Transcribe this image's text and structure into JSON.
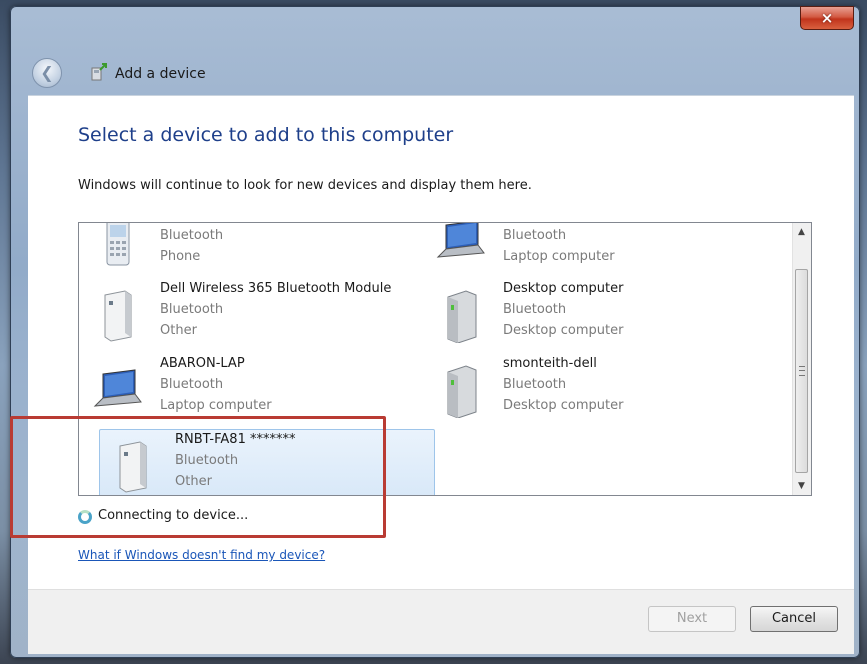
{
  "window": {
    "title": "Add a device",
    "close_label": "×"
  },
  "main": {
    "heading": "Select a device to add to this computer",
    "subtitle": "Windows will continue to look for new devices and display them here.",
    "devices": [
      {
        "name": "",
        "line2": "Bluetooth",
        "line3": "Phone",
        "icon": "phone-icon",
        "selected": false
      },
      {
        "name": "",
        "line2": "Bluetooth",
        "line3": "Laptop computer",
        "icon": "laptop-icon",
        "selected": false
      },
      {
        "name": "Dell Wireless 365 Bluetooth Module",
        "line2": "Bluetooth",
        "line3": "Other",
        "icon": "bluetooth-device-icon",
        "selected": false
      },
      {
        "name": "Desktop computer",
        "line2": "Bluetooth",
        "line3": "Desktop computer",
        "icon": "desktop-tower-icon",
        "selected": false
      },
      {
        "name": "ABARON-LAP",
        "line2": "Bluetooth",
        "line3": "Laptop computer",
        "icon": "laptop-icon",
        "selected": false
      },
      {
        "name": "smonteith-dell",
        "line2": "Bluetooth",
        "line3": "Desktop computer",
        "icon": "desktop-tower-icon",
        "selected": false
      },
      {
        "name": "RNBT-FA81 *******",
        "line2": "Bluetooth",
        "line3": "Other",
        "icon": "bluetooth-device-icon",
        "selected": true
      }
    ],
    "status_text": "Connecting to device...",
    "help_link": "What if Windows doesn't find my device?"
  },
  "footer": {
    "next_label": "Next",
    "cancel_label": "Cancel"
  },
  "colors": {
    "heading": "#1e3f8a",
    "link": "#1a56b8",
    "highlight_box": "#b93b33",
    "selected_bg": "#d8e8f8"
  }
}
